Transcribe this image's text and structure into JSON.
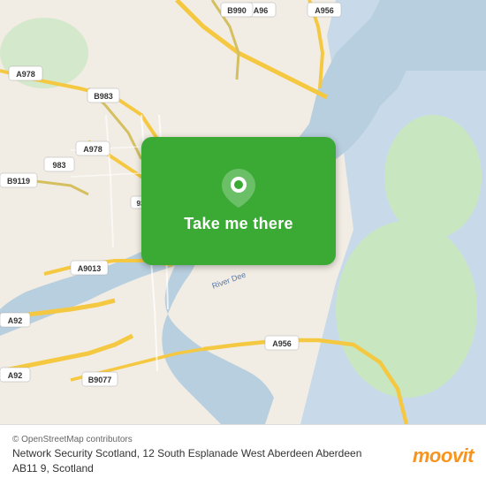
{
  "map": {
    "alt": "Map of Aberdeen, Scotland showing Network Security Scotland location"
  },
  "button": {
    "label": "Take me there",
    "aria": "Navigate to destination"
  },
  "info": {
    "address": "Network Security Scotland, 12 South Esplanade West Aberdeen Aberdeen AB11 9, Scotland"
  },
  "attribution": {
    "text": "© OpenStreetMap contributors"
  },
  "logo": {
    "text": "moovit"
  }
}
